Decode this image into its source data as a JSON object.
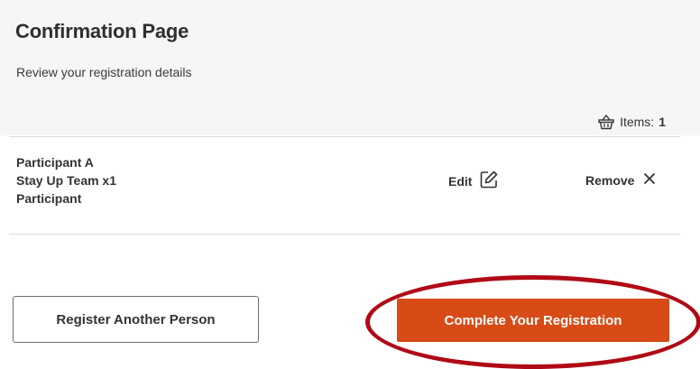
{
  "header": {
    "title": "Confirmation Page",
    "subtitle": "Review your registration details"
  },
  "cart": {
    "items_label": "Items:",
    "items_count": "1",
    "icon": "basket-icon"
  },
  "registration": {
    "participant": "Participant A",
    "team": "Stay Up Team x1",
    "role": "Participant",
    "edit_label": "Edit",
    "remove_label": "Remove"
  },
  "actions": {
    "register_another_label": "Register Another Person",
    "complete_label": "Complete Your Registration"
  },
  "colors": {
    "primary_button": "#d84b16",
    "highlight_ring": "#b00a16",
    "panel_background": "#f6f6f6"
  }
}
